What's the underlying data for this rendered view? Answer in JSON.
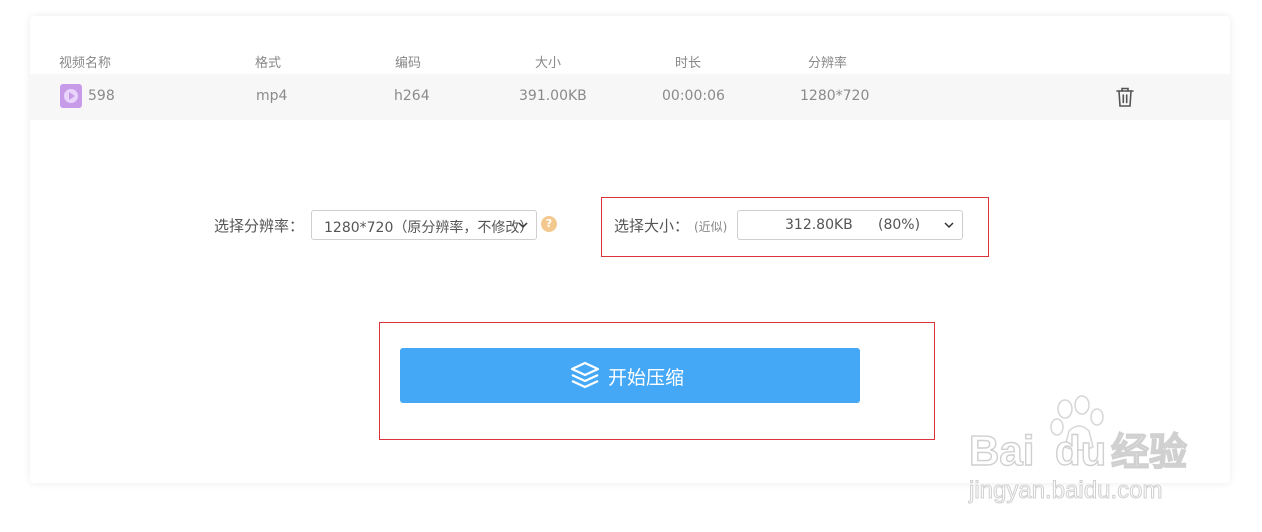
{
  "table": {
    "headers": [
      "视频名称",
      "格式",
      "编码",
      "大小",
      "时长",
      "分辨率"
    ],
    "rows": [
      {
        "name": "598",
        "format": "mp4",
        "codec": "h264",
        "size": "391.00KB",
        "duration": "00:00:06",
        "resolution": "1280*720"
      }
    ]
  },
  "controls": {
    "resolution_label": "选择分辨率：",
    "resolution_value": "1280*720（原分辨率，不修改）",
    "size_label": "选择大小：",
    "size_hint": "(近似)",
    "size_value": "312.80KB",
    "size_percent": "(80%)"
  },
  "start_button": {
    "label": "开始压缩",
    "icon": "layers-icon"
  },
  "icons": {
    "file": "video-file-icon",
    "delete": "trash-icon",
    "help": "question-icon",
    "dropdown": "chevron-down-icon"
  },
  "colors": {
    "primary": "#45a8f7",
    "highlight_box": "#d9343a",
    "file_icon": "#c79be8",
    "help_icon": "#f3c98f"
  },
  "watermark": {
    "brand_a": "Bai",
    "brand_b": "du",
    "brand_c": "经验",
    "url": "jingyan.baidu.com"
  }
}
